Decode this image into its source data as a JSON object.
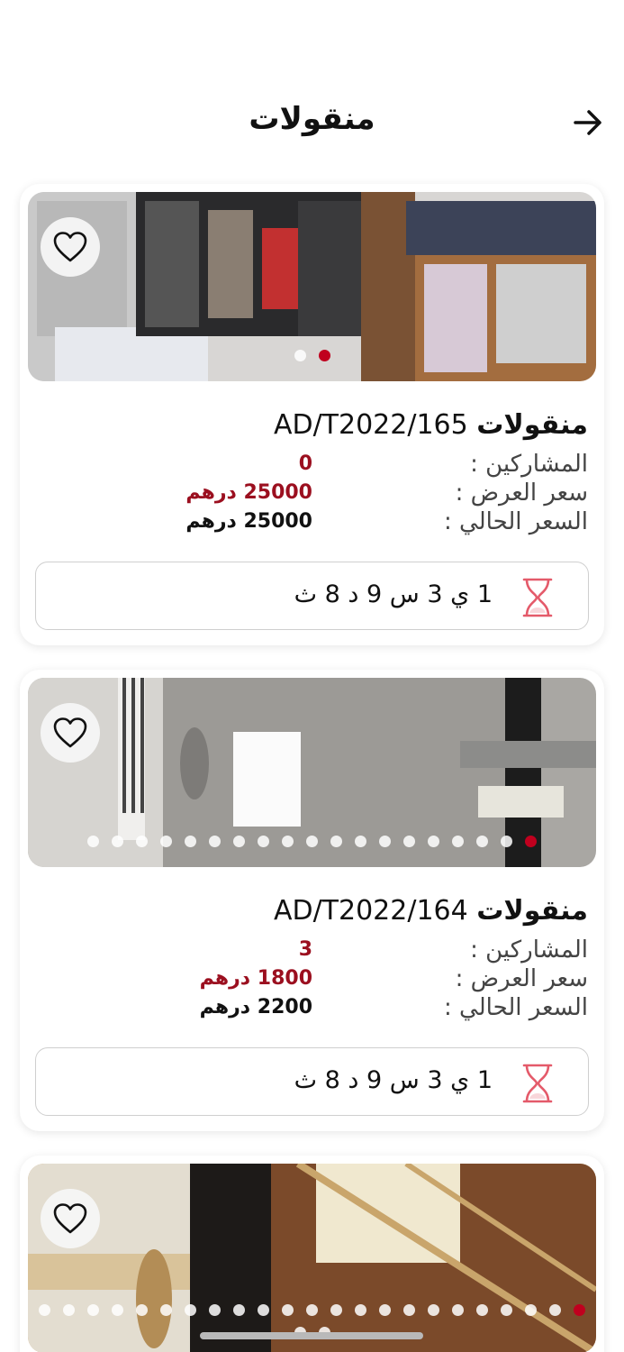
{
  "header": {
    "title": "منقولات",
    "back_icon": "arrow-right-icon"
  },
  "colors": {
    "accent": "#c0001e",
    "price_red": "#9b0f1f",
    "hourglass": "#e45a6a"
  },
  "listings": [
    {
      "title_prefix": "منقولات",
      "title_code": "AD/T2022/165",
      "participants_label": "المشاركين :",
      "participants_value": "0",
      "offer_price_label": "سعر العرض :",
      "offer_price_value": "25000 درهم",
      "current_price_label": "السعر الحالي :",
      "current_price_value": "25000 درهم",
      "countdown": "1 ي 3 س 9 د 8 ث",
      "image_dots": 2,
      "active_dot": 1
    },
    {
      "title_prefix": "منقولات",
      "title_code": "AD/T2022/164",
      "participants_label": "المشاركين :",
      "participants_value": "3",
      "offer_price_label": "سعر العرض :",
      "offer_price_value": "1800 درهم",
      "current_price_label": "السعر الحالي :",
      "current_price_value": "2200 درهم",
      "countdown": "1 ي 3 س 9 د 8 ث",
      "image_dots": 19,
      "active_dot": 18
    },
    {
      "image_dots": 25,
      "active_dot": 22
    }
  ]
}
